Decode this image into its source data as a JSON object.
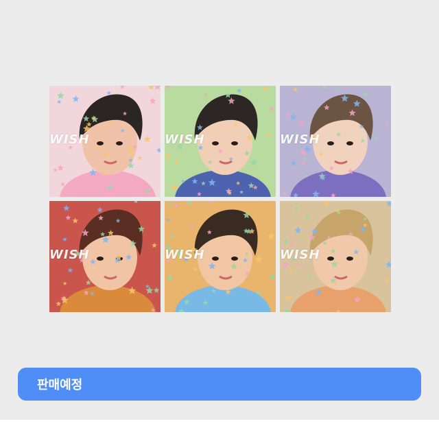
{
  "colors": {
    "background": "#ececec",
    "banner": "#4f8df7",
    "banner_text": "#ffffff"
  },
  "photocards": [
    {
      "wordmark": "WISH",
      "palette": [
        "#f1d6dc",
        "#2b2523",
        "#f0c3a9",
        "#f4a9c2"
      ],
      "description_icon": "photo-member-1"
    },
    {
      "wordmark": "WISH",
      "palette": [
        "#b9dba0",
        "#2c2724",
        "#f1cfb6",
        "#4d63b0"
      ],
      "description_icon": "photo-member-2"
    },
    {
      "wordmark": "WISH",
      "palette": [
        "#b9b3d4",
        "#6c5443",
        "#f0d2be",
        "#7d6fc0"
      ],
      "description_icon": "photo-member-3"
    },
    {
      "wordmark": "WISH",
      "palette": [
        "#c9554c",
        "#5a2e22",
        "#f1c4a6",
        "#d98a3a"
      ],
      "description_icon": "photo-member-4"
    },
    {
      "wordmark": "WISH",
      "palette": [
        "#e9b46b",
        "#3a2b22",
        "#f1c6a3",
        "#78b9e6"
      ],
      "description_icon": "photo-member-5"
    },
    {
      "wordmark": "WISH",
      "palette": [
        "#d9c39c",
        "#c7a46a",
        "#efc9a9",
        "#e9a16b"
      ],
      "description_icon": "photo-member-6"
    }
  ],
  "banner": {
    "label": "판매예정"
  }
}
